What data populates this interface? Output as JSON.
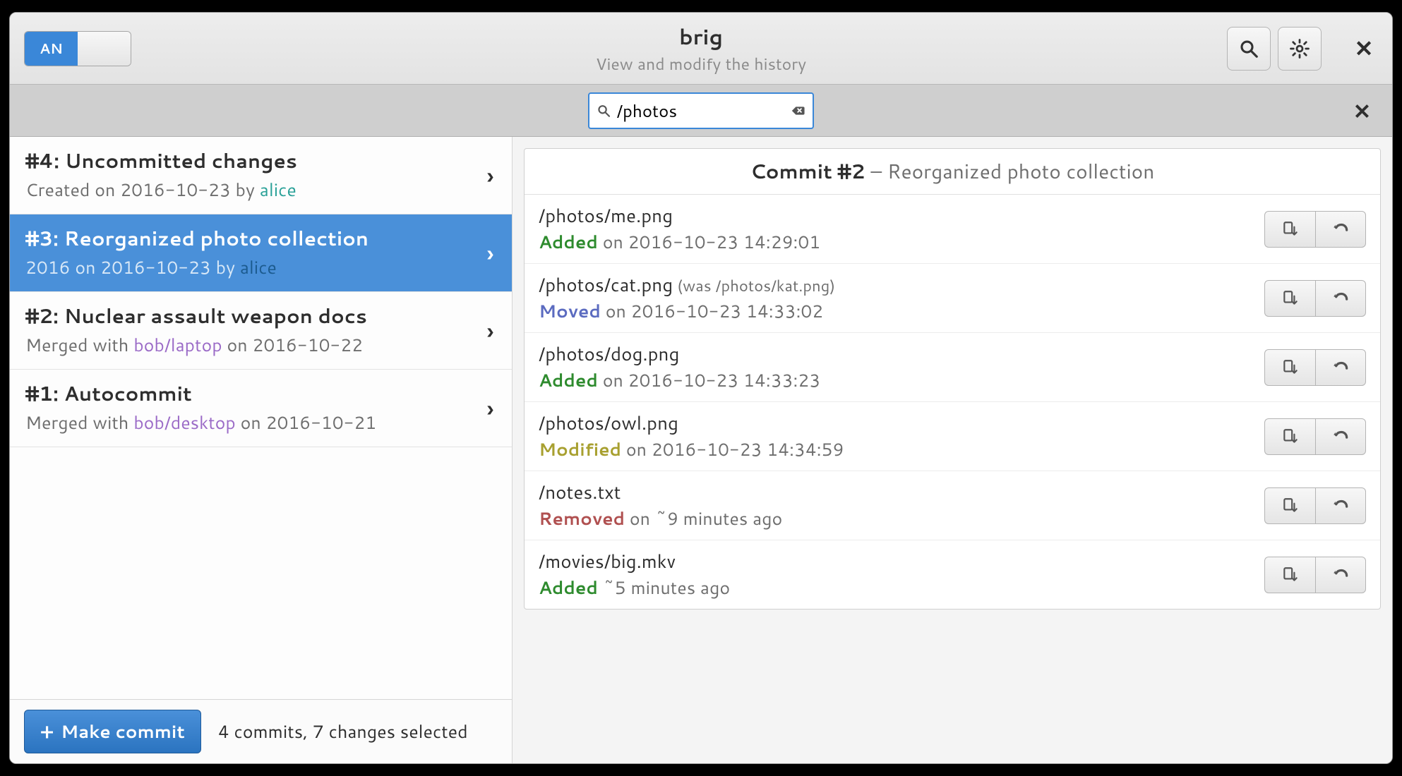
{
  "header": {
    "title": "brig",
    "subtitle": "View and modify the history",
    "switch_label": "AN"
  },
  "search": {
    "value": "/photos"
  },
  "commits": [
    {
      "id": "#4",
      "title": "Uncommitted changes",
      "line2_prefix": "Created on ",
      "date": "2016-10-23",
      "by": " by ",
      "author": "alice",
      "author_kind": "author",
      "selected": false
    },
    {
      "id": "#3",
      "title": "Reorganized photo collection",
      "line2_prefix": "2016 on ",
      "date": "2016-10-23",
      "by": " by ",
      "author": "alice",
      "author_kind": "author",
      "selected": true
    },
    {
      "id": "#2",
      "title": "Nuclear assault weapon docs",
      "line2_prefix": "Merged with ",
      "author": "bob/laptop",
      "author_kind": "peer",
      "by": "",
      "date_suffix": " on 2016-10-22",
      "selected": false
    },
    {
      "id": "#1",
      "title": "Autocommit",
      "line2_prefix": "Merged with ",
      "author": "bob/desktop",
      "author_kind": "peer",
      "by": "",
      "date_suffix": " on 2016-10-21",
      "selected": false
    }
  ],
  "footer": {
    "button": "Make commit",
    "status": "4 commits, 7 changes selected"
  },
  "detail": {
    "header_prefix": "Commit #2",
    "header_rest": " – Reorganized photo collection",
    "files": [
      {
        "path": "/photos/me.png",
        "was": "",
        "tag": "Added",
        "tag_class": "added",
        "meta": " on 2016-10-23 14:29:01"
      },
      {
        "path": "/photos/cat.png",
        "was": " (was /photos/kat.png)",
        "tag": "Moved",
        "tag_class": "moved",
        "meta": " on 2016-10-23 14:33:02"
      },
      {
        "path": "/photos/dog.png",
        "was": "",
        "tag": "Added",
        "tag_class": "added",
        "meta": " on 2016-10-23 14:33:23"
      },
      {
        "path": "/photos/owl.png",
        "was": "",
        "tag": "Modified",
        "tag_class": "modified",
        "meta": " on 2016-10-23 14:34:59"
      },
      {
        "path": "/notes.txt",
        "was": "",
        "tag": "Removed",
        "tag_class": "removed",
        "meta": " on ~9 minutes ago"
      },
      {
        "path": "/movies/big.mkv",
        "was": "",
        "tag": "Added",
        "tag_class": "added",
        "meta": " ~5 minutes ago"
      }
    ]
  }
}
